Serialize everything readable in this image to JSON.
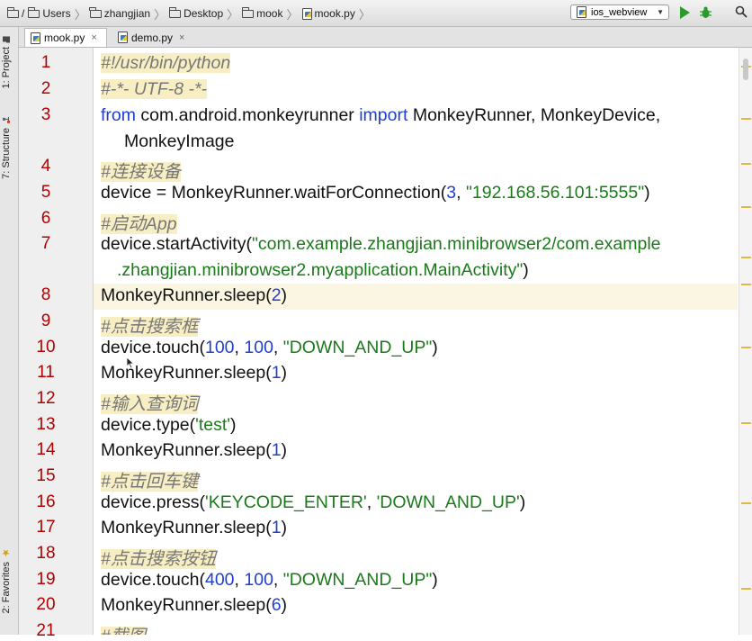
{
  "breadcrumbs": [
    {
      "label": "/",
      "icon": "folder-icon"
    },
    {
      "label": "Users",
      "icon": "folder-icon"
    },
    {
      "label": "zhangjian",
      "icon": "folder-icon"
    },
    {
      "label": "Desktop",
      "icon": "folder-icon"
    },
    {
      "label": "mook",
      "icon": "folder-icon"
    },
    {
      "label": "mook.py",
      "icon": "python-file-icon"
    }
  ],
  "run_config": {
    "label": "ios_webview",
    "icon": "python-file-icon"
  },
  "toolbar_icons": [
    "run-icon",
    "debug-icon",
    "search-icon"
  ],
  "tool_windows": [
    {
      "label": "1: Project",
      "icon": "project-icon"
    },
    {
      "label": "7: Structure",
      "icon": "structure-icon"
    },
    {
      "label": "2: Favorites",
      "icon": "star-icon"
    }
  ],
  "tabs": [
    {
      "label": "mook.py",
      "close": "×",
      "active": true
    },
    {
      "label": "demo.py",
      "close": "×",
      "active": false
    }
  ],
  "line_numbers": [
    "1",
    "2",
    "3",
    "4",
    "5",
    "6",
    "7",
    "8",
    "9",
    "10",
    "11",
    "12",
    "13",
    "14",
    "15",
    "16",
    "17",
    "18",
    "19",
    "20",
    "21"
  ],
  "code": {
    "l1": {
      "c": "#!/usr/bin/python"
    },
    "l2": {
      "c": "#-*- UTF-8 -*-"
    },
    "l3": {
      "kw1": "from",
      "t1": " com.android.monkeyrunner ",
      "kw2": "import",
      "t2": " MonkeyRunner, MonkeyDevice,"
    },
    "l3b": {
      "t": "MonkeyImage"
    },
    "l4": {
      "c": "#连接设备"
    },
    "l5": {
      "t1": "device = MonkeyRunner.waitForConnection(",
      "n1": "3",
      "t2": ", ",
      "s1": "\"192.168.56.101:5555\"",
      "t3": ")"
    },
    "l6": {
      "c": "#启动App"
    },
    "l7": {
      "t1": "device.startActivity(",
      "s1": "\"com.example.zhangjian.minibrowser2/com.example"
    },
    "l7b": {
      "s1": ".zhangjian.minibrowser2.myapplication.MainActivity\"",
      "t1": ")"
    },
    "l8": {
      "t1": "MonkeyRunner.sleep(",
      "n1": "2",
      "t2": ")"
    },
    "l9": {
      "c": "#点击搜索框"
    },
    "l10": {
      "t1": "device.touch(",
      "n1": "100",
      "t2": ", ",
      "n2": "100",
      "t3": ", ",
      "s1": "\"DOWN_AND_UP\"",
      "t4": ")"
    },
    "l11": {
      "t1": "MonkeyRunner.sleep(",
      "n1": "1",
      "t2": ")"
    },
    "l12": {
      "c": "#输入查询词"
    },
    "l13": {
      "t1": "device.type(",
      "s1": "'test'",
      "t2": ")"
    },
    "l14": {
      "t1": "MonkeyRunner.sleep(",
      "n1": "1",
      "t2": ")"
    },
    "l15": {
      "c": "#点击回车键"
    },
    "l16": {
      "t1": "device.press(",
      "s1": "'KEYCODE_ENTER'",
      "t2": ", ",
      "s2": "'DOWN_AND_UP'",
      "t3": ")"
    },
    "l17": {
      "t1": "MonkeyRunner.sleep(",
      "n1": "1",
      "t2": ")"
    },
    "l18": {
      "c": "#点击搜索按钮"
    },
    "l19": {
      "t1": "device.touch(",
      "n1": "400",
      "t2": ", ",
      "n2": "100",
      "t3": ", ",
      "s1": "\"DOWN_AND_UP\"",
      "t4": ")"
    },
    "l20": {
      "t1": "MonkeyRunner.sleep(",
      "n1": "6",
      "t2": ")"
    },
    "l21": {
      "c": "#截图"
    }
  },
  "colors": {
    "keyword": "#1e3fd0",
    "string": "#1a7a1a",
    "comment": "#777777",
    "line_number": "#b30000",
    "caret_row": "#fbf6e1"
  }
}
